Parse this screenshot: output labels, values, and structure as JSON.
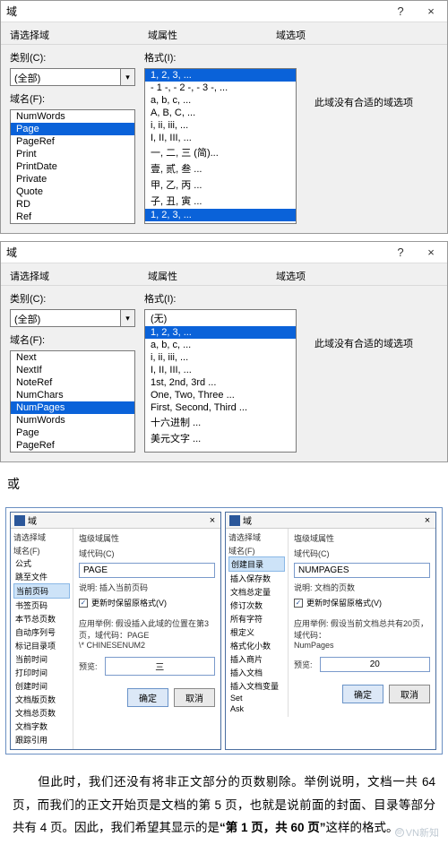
{
  "dialogTop": {
    "title": "域",
    "help": "?",
    "close": "×",
    "header": {
      "c1": "请选择域",
      "c2": "域属性",
      "c3": "域选项"
    },
    "cat": {
      "label": "类别(C):",
      "value": "(全部)"
    },
    "fname": {
      "label": "域名(F):"
    },
    "fieldList": [
      "NumWords",
      "Page",
      "PageRef",
      "Print",
      "PrintDate",
      "Private",
      "Quote",
      "RD",
      "Ref"
    ],
    "fieldSelected": "Page",
    "fmt": {
      "label": "格式(I):"
    },
    "fmtList": [
      "1, 2, 3, ...",
      "- 1 -, - 2 -, - 3 -, ...",
      "a, b, c, ...",
      "A, B, C, ...",
      "i, ii, iii, ...",
      "I, II, III, ...",
      "一, 二, 三 (简)...",
      "壹, 贰, 叁 ...",
      "甲, 乙, 丙 ...",
      "子, 丑, 寅 ...",
      "1, 2, 3, ..."
    ],
    "fmtSelected": "1, 2, 3, ...",
    "noOption": "此域没有合适的域选项"
  },
  "dialogMid": {
    "title": "域",
    "help": "?",
    "close": "×",
    "header": {
      "c1": "请选择域",
      "c2": "域属性",
      "c3": "域选项"
    },
    "cat": {
      "label": "类别(C):",
      "value": "(全部)"
    },
    "fname": {
      "label": "域名(F):"
    },
    "fieldList": [
      "Next",
      "NextIf",
      "NoteRef",
      "NumChars",
      "NumPages",
      "NumWords",
      "Page",
      "PageRef"
    ],
    "fieldSelected": "NumPages",
    "fmt": {
      "label": "格式(I):"
    },
    "fmtList": [
      "(无)",
      "1, 2, 3, ...",
      "a, b, c, ...",
      "i, ii, iii, ...",
      "I, II, III, ...",
      "1st, 2nd, 3rd ...",
      "One, Two, Three ...",
      "First, Second, Third ...",
      "十六进制 ...",
      "美元文字 ..."
    ],
    "fmtSelected": "1, 2, 3, ...",
    "noOption": "此域没有合适的域选项"
  },
  "orLabel": "或",
  "mini1": {
    "title": "域",
    "advTitle": "塩级域属性",
    "col1Label": "请选择域",
    "fnameLabel": "域名(F)",
    "codeLabel": "域代码(C)",
    "codeValue": "PAGE",
    "sub": "说明: 插入当前页码",
    "chk": "更新时保留原格式(V)",
    "items": [
      "公式",
      "跳至文件",
      "当前页码",
      "书签页码",
      "本节总页数",
      "自动序列号",
      "标记目录项",
      "当前时间",
      "打印时间",
      "创建时间",
      "文档版页数",
      "文档总页数",
      "文档字数",
      "跟踪引用"
    ],
    "itemSelected": "当前页码",
    "note1": "应用举例: 假设插入此域的位置在第3页，域代码：PAGE",
    "note2": "\\* CHINESENUM2",
    "previewLabel": "预览:",
    "preview": "三",
    "ok": "确定",
    "cancel": "取消"
  },
  "mini2": {
    "title": "域",
    "advTitle": "塩级域属性",
    "col1Label": "请选择域",
    "fnameLabel": "域名(F)",
    "codeLabel": "域代码(C)",
    "codeValue": "NUMPAGES",
    "sub": "说明: 文档的页数",
    "chk": "更新时保留原格式(V)",
    "items": [
      "创建目录",
      "插入保存数",
      "文档总定量",
      "修订次数",
      "所有字符",
      "根定义",
      "格式化小数",
      "插入商片",
      "插入文档",
      "插入文档变量",
      "Set",
      "Ask"
    ],
    "itemSelected": "创建目录",
    "note1": "应用举例: 假设当前文档总共有20页，域代码：",
    "note2": "NumPages",
    "previewLabel": "预览:",
    "preview": "20",
    "ok": "确定",
    "cancel": "取消"
  },
  "para": {
    "line1": "　　但此时，我们还没有将非正文部分的页数剔除。举例说明，文档一共 64 页，而我们的正文开始页是文档的第 5 页，也就是说前面的封面、目录等部分共有 4 页。因此，我们希望其显示的是",
    "bold": "“第 1 页，共 60 页”",
    "line2": "这样的格式。"
  },
  "watermark": "VN新知"
}
